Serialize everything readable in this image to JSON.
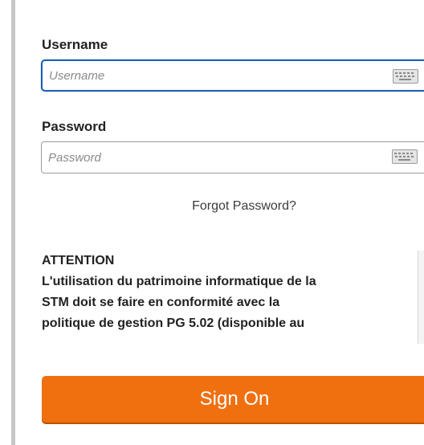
{
  "login_form": {
    "username": {
      "label": "Username",
      "placeholder": "Username",
      "value": ""
    },
    "password": {
      "label": "Password",
      "placeholder": "Password",
      "value": ""
    },
    "forgot_link": "Forgot Password?",
    "notice": {
      "heading": "ATTENTION",
      "lines": [
        "L'utilisation du patrimoine informatique de la",
        "STM doit se faire en conformité avec la",
        "politique de gestion PG 5.02 (disponible au"
      ]
    },
    "submit_label": "Sign On"
  },
  "icons": {
    "field_keyboard": "keyboard-icon"
  },
  "colors": {
    "accent": "#f07010",
    "focus_border": "#1a5fb4",
    "text": "#222222"
  }
}
